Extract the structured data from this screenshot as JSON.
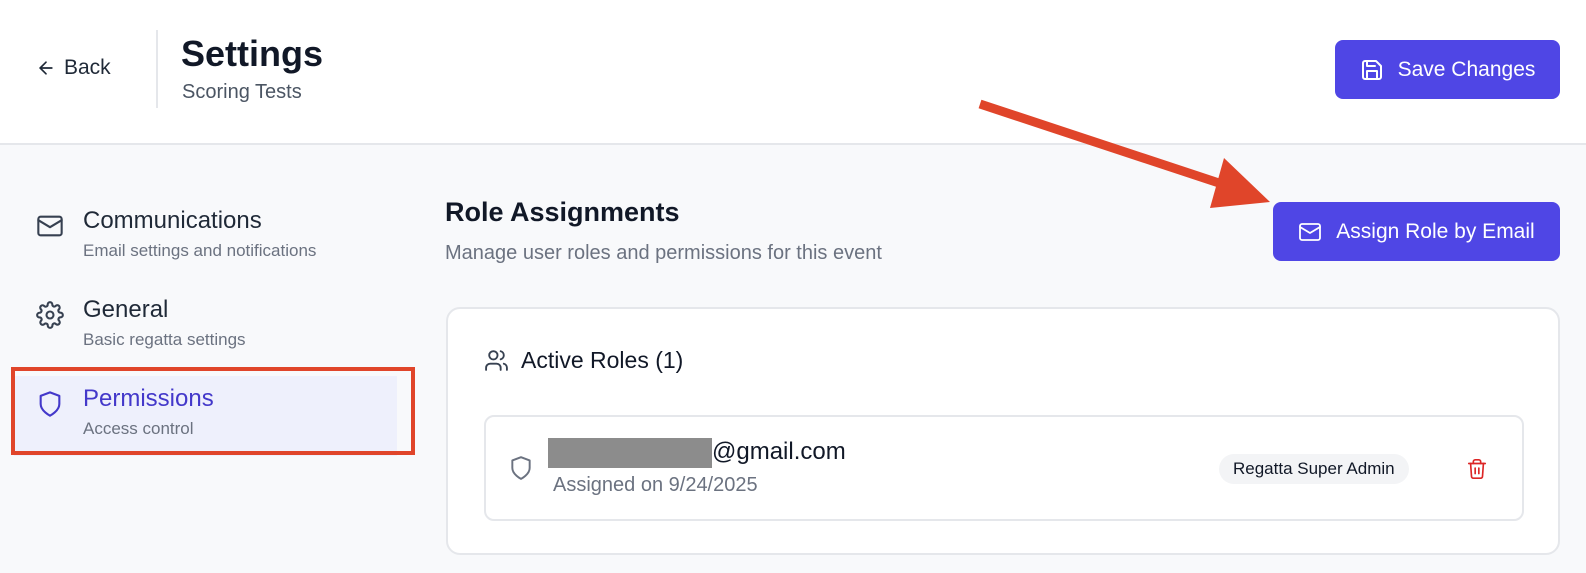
{
  "header": {
    "back_label": "Back",
    "title": "Settings",
    "subtitle": "Scoring Tests",
    "save_label": "Save Changes"
  },
  "sidebar": {
    "items": [
      {
        "label": "Communications",
        "description": "Email settings and notifications",
        "icon": "mail-icon"
      },
      {
        "label": "General",
        "description": "Basic regatta settings",
        "icon": "gear-icon"
      },
      {
        "label": "Permissions",
        "description": "Access control",
        "icon": "shield-icon",
        "active": true
      }
    ]
  },
  "main": {
    "title": "Role Assignments",
    "description": "Manage user roles and permissions for this event",
    "assign_label": "Assign Role by Email",
    "card": {
      "title": "Active Roles (1)",
      "roles": [
        {
          "email": "@gmail.com",
          "assigned": "Assigned on 9/24/2025",
          "role": "Regatta Super Admin"
        }
      ]
    }
  },
  "colors": {
    "accent": "#4f46e5",
    "annotation": "#e0452a",
    "active_bg": "#eef0fc",
    "danger": "#dc2626"
  }
}
